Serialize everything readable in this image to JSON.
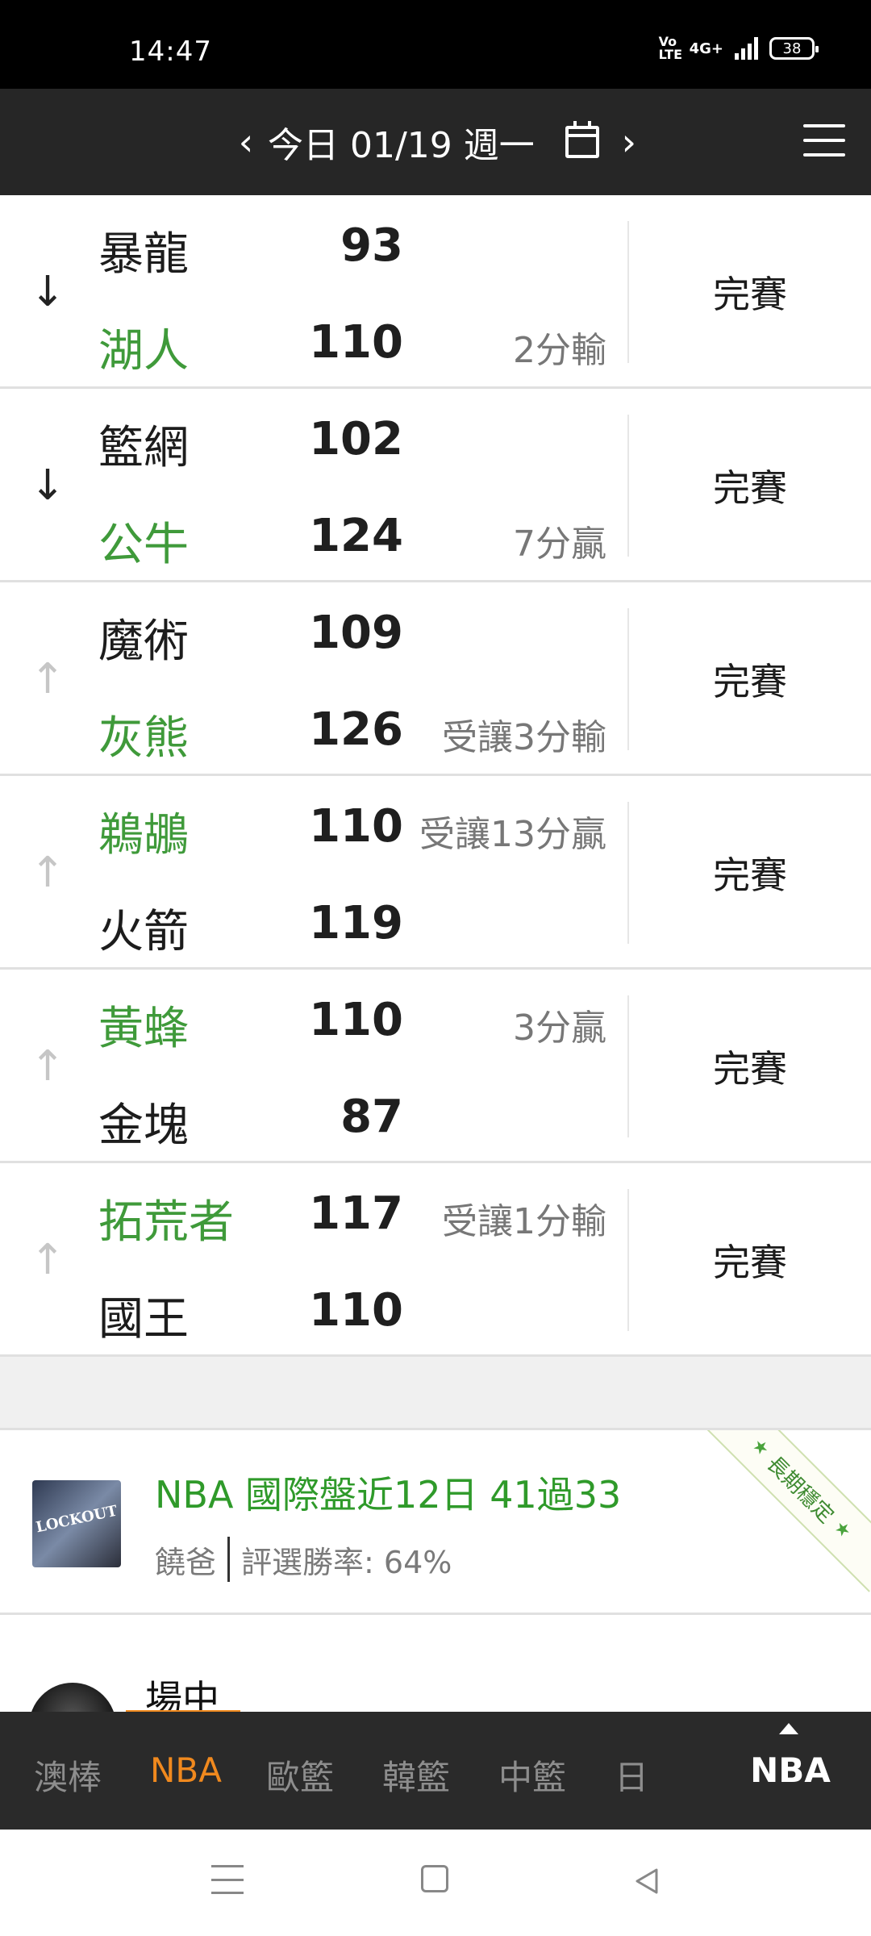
{
  "status_bar": {
    "time": "14:47",
    "volte": "Vo\nLTE",
    "network": "4G+",
    "battery": "38"
  },
  "header": {
    "date_label": "今日 01/19 週一",
    "prev_icon": "chevron-left-icon",
    "next_icon": "chevron-right-icon",
    "calendar_icon": "calendar-icon",
    "menu_icon": "hamburger-menu-icon"
  },
  "games": [
    {
      "trend": "down",
      "home": {
        "name": "暴龍",
        "score": "93",
        "favored": false,
        "note": ""
      },
      "away": {
        "name": "湖人",
        "score": "110",
        "favored": true,
        "note": "2分輸"
      },
      "status": "完賽"
    },
    {
      "trend": "down",
      "home": {
        "name": "籃網",
        "score": "102",
        "favored": false,
        "note": ""
      },
      "away": {
        "name": "公牛",
        "score": "124",
        "favored": true,
        "note": "7分贏"
      },
      "status": "完賽"
    },
    {
      "trend": "up",
      "home": {
        "name": "魔術",
        "score": "109",
        "favored": false,
        "note": ""
      },
      "away": {
        "name": "灰熊",
        "score": "126",
        "favored": true,
        "note": "受讓3分輸"
      },
      "status": "完賽"
    },
    {
      "trend": "up",
      "home": {
        "name": "鵜鶘",
        "score": "110",
        "favored": true,
        "note": "受讓13分贏"
      },
      "away": {
        "name": "火箭",
        "score": "119",
        "favored": false,
        "note": ""
      },
      "status": "完賽"
    },
    {
      "trend": "up",
      "home": {
        "name": "黃蜂",
        "score": "110",
        "favored": true,
        "note": "3分贏"
      },
      "away": {
        "name": "金塊",
        "score": "87",
        "favored": false,
        "note": ""
      },
      "status": "完賽"
    },
    {
      "trend": "up",
      "home": {
        "name": "拓荒者",
        "score": "117",
        "favored": true,
        "note": "受讓1分輸"
      },
      "away": {
        "name": "國王",
        "score": "110",
        "favored": false,
        "note": ""
      },
      "status": "完賽"
    }
  ],
  "promo": {
    "thumb_text": "LOCKOUT",
    "title": "NBA 國際盤近12日 41過33",
    "author": "饒爸",
    "win_rate": "評選勝率: 64%",
    "ribbon": "長期穩定"
  },
  "live": {
    "tab_label": "場中"
  },
  "league_tabs": [
    {
      "label": "澳棒",
      "active": false
    },
    {
      "label": "NBA",
      "active": true
    },
    {
      "label": "歐籃",
      "active": false
    },
    {
      "label": "韓籃",
      "active": false
    },
    {
      "label": "中籃",
      "active": false
    },
    {
      "label": "日",
      "active": false
    }
  ],
  "current_league": "NBA",
  "colors": {
    "favored_green": "#3f9a3a",
    "accent_orange": "#f0891e",
    "header_bg": "#262626"
  }
}
